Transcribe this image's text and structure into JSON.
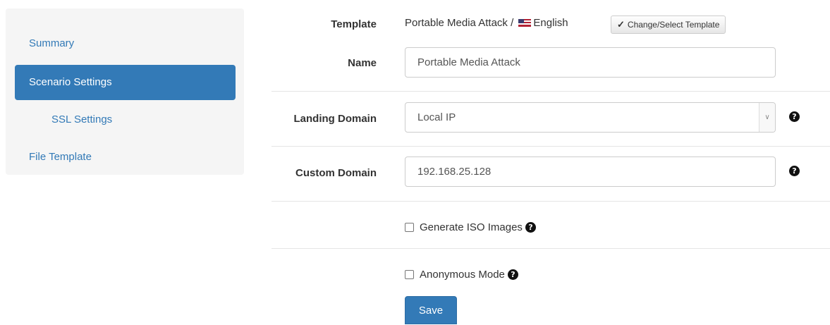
{
  "sidebar": {
    "items": [
      {
        "label": "Summary"
      },
      {
        "label": "Scenario Settings"
      },
      {
        "label": "SSL Settings"
      },
      {
        "label": "File Template"
      }
    ]
  },
  "form": {
    "template": {
      "label": "Template",
      "value_prefix": "Portable Media Attack /",
      "language": "English",
      "button_label": "Change/Select Template"
    },
    "name": {
      "label": "Name",
      "value": "Portable Media Attack"
    },
    "landing_domain": {
      "label": "Landing Domain",
      "value": "Local IP"
    },
    "custom_domain": {
      "label": "Custom Domain",
      "value": "192.168.25.128"
    },
    "generate_iso": {
      "label": "Generate ISO Images",
      "checked": false
    },
    "anonymous_mode": {
      "label": "Anonymous Mode",
      "checked": false
    },
    "save_label": "Save"
  },
  "icons": {
    "help": "question-circle-icon",
    "edit": "edit-icon",
    "flag": "us-flag-icon",
    "dropdown": "chevron-down-icon"
  },
  "colors": {
    "primary": "#337ab7",
    "sidebar_bg": "#f5f5f5",
    "border": "#cccccc"
  }
}
